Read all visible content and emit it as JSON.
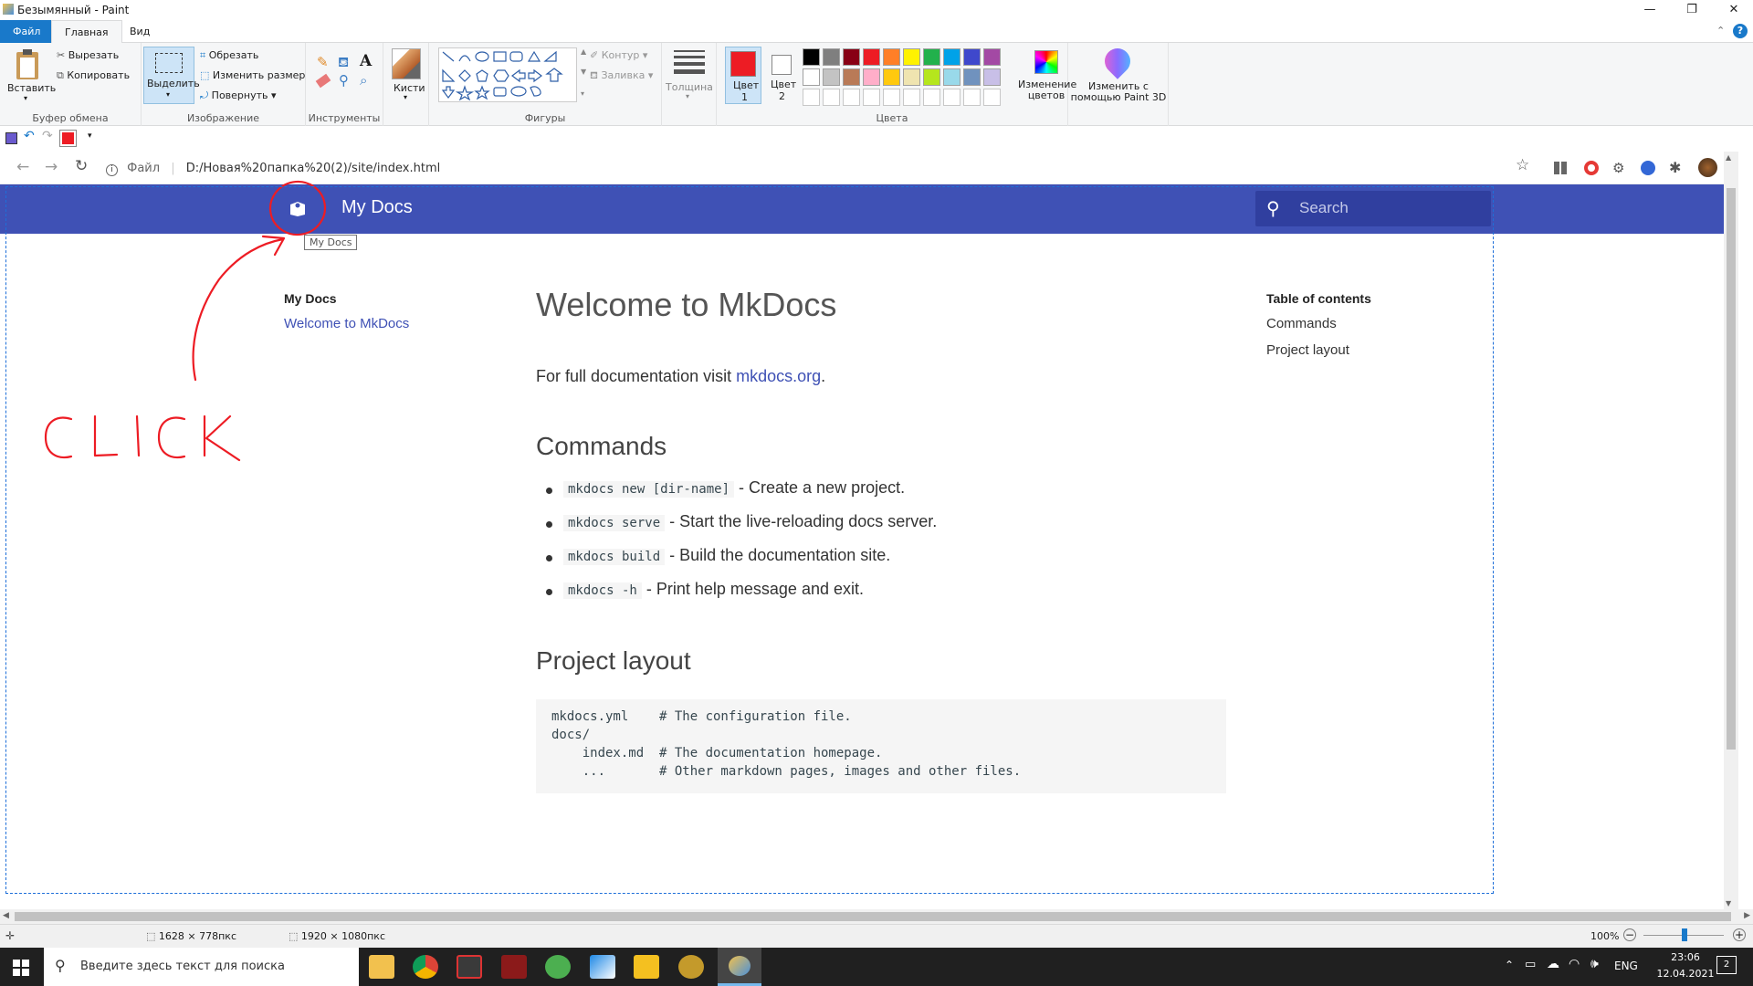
{
  "paint": {
    "window_title": "Безымянный - Paint",
    "tabs": [
      "Файл",
      "Главная",
      "Вид"
    ],
    "clipboard": {
      "paste": "Вставить",
      "cut": "Вырезать",
      "copy": "Копировать",
      "label": "Буфер обмена"
    },
    "image": {
      "select": "Выделить",
      "crop": "Обрезать",
      "resize": "Изменить размер",
      "rotate": "Повернуть",
      "label": "Изображение"
    },
    "tools": {
      "label": "Инструменты"
    },
    "brushes": {
      "label": "Кисти"
    },
    "shapes": {
      "outline": "Контур",
      "fill": "Заливка",
      "label": "Фигуры"
    },
    "size": {
      "label": "Толщина"
    },
    "color1": {
      "line1": "Цвет",
      "line2": "1",
      "value": "#ed1c24"
    },
    "color2": {
      "line1": "Цвет",
      "line2": "2",
      "value": "#ffffff"
    },
    "colors": {
      "label": "Цвета",
      "row1": [
        "#000000",
        "#7f7f7f",
        "#880015",
        "#ed1c24",
        "#ff7f27",
        "#fff200",
        "#22b14c",
        "#00a2e8",
        "#3f48cc",
        "#a349a4"
      ],
      "row2": [
        "#ffffff",
        "#c3c3c3",
        "#b97a57",
        "#ffaec9",
        "#ffc90e",
        "#efe4b0",
        "#b5e61d",
        "#99d9ea",
        "#7092be",
        "#c8bfe7"
      ]
    },
    "edit_colors": {
      "line1": "Изменение",
      "line2": "цветов"
    },
    "paint3d": {
      "line1": "Изменить с",
      "line2": "помощью Paint 3D"
    },
    "status": {
      "selection_size": "1628 × 778пкс",
      "image_size": "1920 × 1080пкс",
      "zoom": "100%"
    }
  },
  "browser": {
    "file_label": "Файл",
    "url": "D:/Новая%20папка%20(2)/site/index.html"
  },
  "mkdocs": {
    "site_title": "My Docs",
    "tooltip": "My Docs",
    "search_placeholder": "Search",
    "nav_heading": "My Docs",
    "nav_link": "Welcome to MkDocs",
    "h1": "Welcome to MkDocs",
    "intro_text": "For full documentation visit ",
    "intro_link": "mkdocs.org",
    "intro_end": ".",
    "commands_heading": "Commands",
    "commands": [
      {
        "code": "mkdocs new [dir-name]",
        "desc": " - Create a new project."
      },
      {
        "code": "mkdocs serve",
        "desc": " - Start the live-reloading docs server."
      },
      {
        "code": "mkdocs build",
        "desc": " - Build the documentation site."
      },
      {
        "code": "mkdocs -h",
        "desc": " - Print help message and exit."
      }
    ],
    "layout_heading": "Project layout",
    "layout_code": [
      "mkdocs.yml    # The configuration file.",
      "docs/",
      "    index.md  # The documentation homepage.",
      "    ...       # Other markdown pages, images and other files."
    ],
    "toc_heading": "Table of contents",
    "toc_items": [
      "Commands",
      "Project layout"
    ]
  },
  "annotation": {
    "text": "CLICK",
    "color": "#ed1c24"
  },
  "taskbar": {
    "search_placeholder": "Введите здесь текст для поиска",
    "lang": "ENG",
    "time": "23:06",
    "date": "12.04.2021",
    "notifications": "2"
  }
}
